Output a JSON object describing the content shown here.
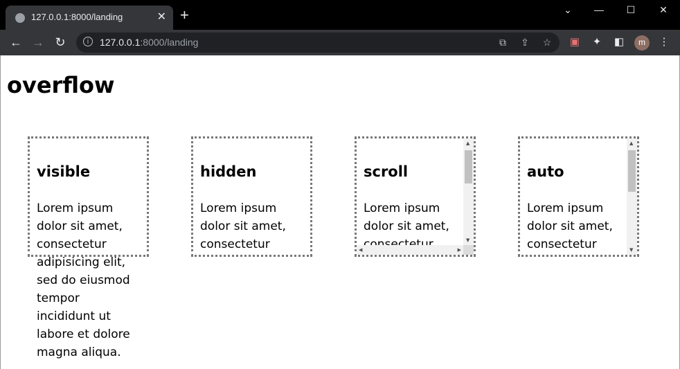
{
  "browser": {
    "tab_title": "127.0.0.1:8000/landing",
    "url_host": "127.0.0.1",
    "url_rest": ":8000/landing",
    "avatar_letter": "m"
  },
  "page": {
    "heading": "overflow"
  },
  "boxes": [
    {
      "title": "visible",
      "text": "Lorem ipsum dolor sit amet, consectetur adipisicing elit, sed do eiusmod tempor incididunt ut labore et dolore magna aliqua."
    },
    {
      "title": "hidden",
      "text": "Lorem ipsum dolor sit amet, consectetur adipisicing elit, sed do eiusmod tempor incididunt ut labore et dolore magna aliqua."
    },
    {
      "title": "scroll",
      "text": "Lorem ipsum dolor sit amet, consectetur adipisicing elit, sed do eiusmod tempor incididunt ut labore et dolore magna aliqua."
    },
    {
      "title": "auto",
      "text": "Lorem ipsum dolor sit amet, consectetur adipisicing elit, sed do eiusmod tempor incididunt ut labore et dolore magna aliqua."
    }
  ]
}
